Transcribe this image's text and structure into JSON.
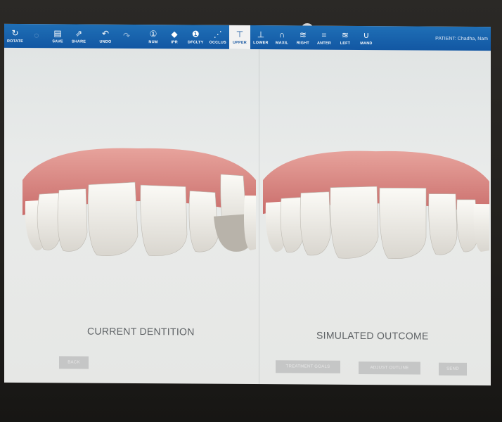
{
  "toolbar": {
    "items": [
      {
        "label": "ROTATE",
        "icon": "rotate-icon",
        "glyph": "↻"
      },
      {
        "label": "",
        "icon": "unknown-icon",
        "glyph": "◌"
      },
      {
        "label": "SAVE",
        "icon": "save-icon",
        "glyph": "▤"
      },
      {
        "label": "SHARE",
        "icon": "share-icon",
        "glyph": "⇗"
      },
      {
        "label": "UNDO",
        "icon": "undo-icon",
        "glyph": "↶"
      },
      {
        "label": "",
        "icon": "redo-icon",
        "glyph": "↷"
      },
      {
        "label": "NUM",
        "icon": "num-icon",
        "glyph": "①"
      },
      {
        "label": "IPR",
        "icon": "ipr-icon",
        "glyph": "◆"
      },
      {
        "label": "DFCLTY",
        "icon": "difficulty-icon",
        "glyph": "❶"
      },
      {
        "label": "OCCLUS",
        "icon": "occlusion-icon",
        "glyph": "⋰"
      },
      {
        "label": "UPPER",
        "icon": "upper-icon",
        "glyph": "⊤",
        "active": true
      },
      {
        "label": "LOWER",
        "icon": "lower-icon",
        "glyph": "⊥"
      },
      {
        "label": "MAXIL",
        "icon": "maxillary-icon",
        "glyph": "∩"
      },
      {
        "label": "RIGHT",
        "icon": "right-view-icon",
        "glyph": "≋"
      },
      {
        "label": "ANTER",
        "icon": "anterior-view-icon",
        "glyph": "="
      },
      {
        "label": "LEFT",
        "icon": "left-view-icon",
        "glyph": "≋"
      },
      {
        "label": "MAND",
        "icon": "mandibular-icon",
        "glyph": "∪"
      }
    ],
    "patient": "PATIENT: Chadha, Nam"
  },
  "panels": {
    "left_caption": "CURRENT DENTITION",
    "right_caption": "SIMULATED OUTCOME"
  },
  "buttons": {
    "back": "BACK",
    "treatment_goals": "TREATMENT GOALS",
    "adjust_outline": "ADJUST OUTLINE",
    "send": "SEND"
  },
  "colors": {
    "toolbar": "#1565ad",
    "gum": "#d98a86",
    "tooth": "#f4f1ea"
  }
}
